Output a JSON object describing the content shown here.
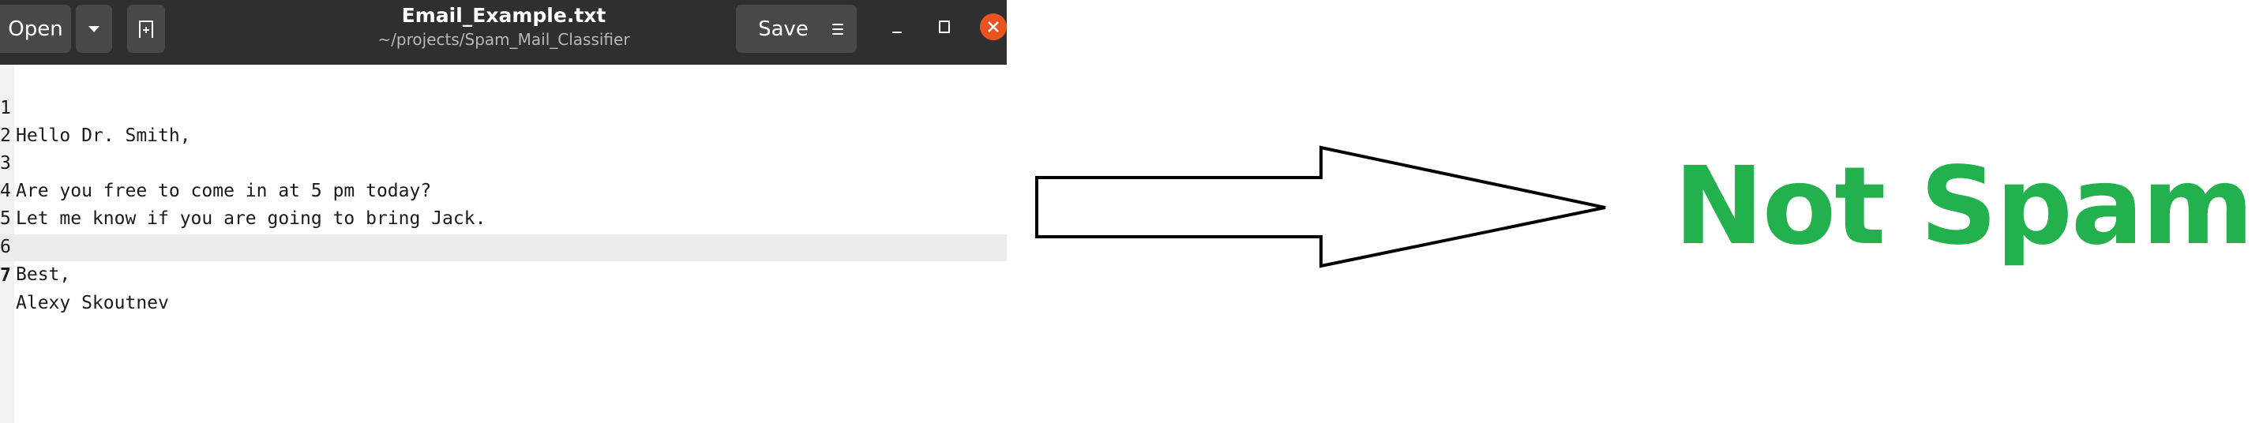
{
  "header": {
    "open_label": "Open",
    "save_label": "Save",
    "title": "Email_Example.txt",
    "subtitle": "~/projects/Spam_Mail_Classifier"
  },
  "editor": {
    "lines": [
      {
        "number": "1",
        "text": "Hello Dr. Smith,"
      },
      {
        "number": "2",
        "text": ""
      },
      {
        "number": "3",
        "text": "Are you free to come in at 5 pm today?"
      },
      {
        "number": "4",
        "text": "Let me know if you are going to bring Jack."
      },
      {
        "number": "5",
        "text": ""
      },
      {
        "number": "6",
        "text": "Best,"
      },
      {
        "number": "7",
        "text": "Alexy Skoutnev"
      }
    ]
  },
  "result": {
    "label": "Not Spam",
    "color": "#22b14c"
  },
  "icons": {
    "open_menu": "chevron-down-icon",
    "new_tab": "new-document-icon",
    "menu": "hamburger-icon",
    "minimize": "minimize-icon",
    "maximize": "maximize-icon",
    "close": "close-icon",
    "diagram": "right-arrow-icon"
  },
  "colors": {
    "headerbar": "#2f2f2f",
    "button": "#484848",
    "close": "#e95420",
    "current_line": "#ececec"
  }
}
